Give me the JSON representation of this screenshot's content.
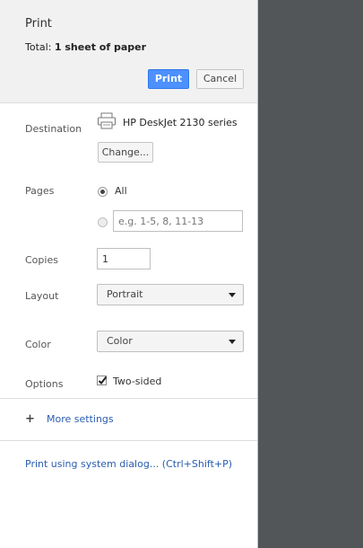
{
  "header": {
    "title": "Print",
    "summary_prefix": "Total: ",
    "summary_bold": "1 sheet of paper",
    "print_label": "Print",
    "cancel_label": "Cancel"
  },
  "destination": {
    "label": "Destination",
    "printer_name": "HP DeskJet 2130 series",
    "change_label": "Change...",
    "icon": "printer-icon"
  },
  "pages": {
    "label": "Pages",
    "all_label": "All",
    "all_selected": true,
    "custom_placeholder": "e.g. 1-5, 8, 11-13"
  },
  "copies": {
    "label": "Copies",
    "value": "1"
  },
  "layout": {
    "label": "Layout",
    "selected": "Portrait"
  },
  "color": {
    "label": "Color",
    "selected": "Color"
  },
  "options": {
    "label": "Options",
    "two_sided_label": "Two-sided",
    "two_sided_checked": true
  },
  "more_settings": {
    "label": "More settings",
    "icon": "plus-icon"
  },
  "system_dialog": {
    "label": "Print using system dialog... (Ctrl+Shift+P)"
  },
  "colors": {
    "primary_button": "#4d90fe",
    "link": "#2a5db0",
    "preview_background": "#525659",
    "header_background": "#f1f1f1"
  }
}
